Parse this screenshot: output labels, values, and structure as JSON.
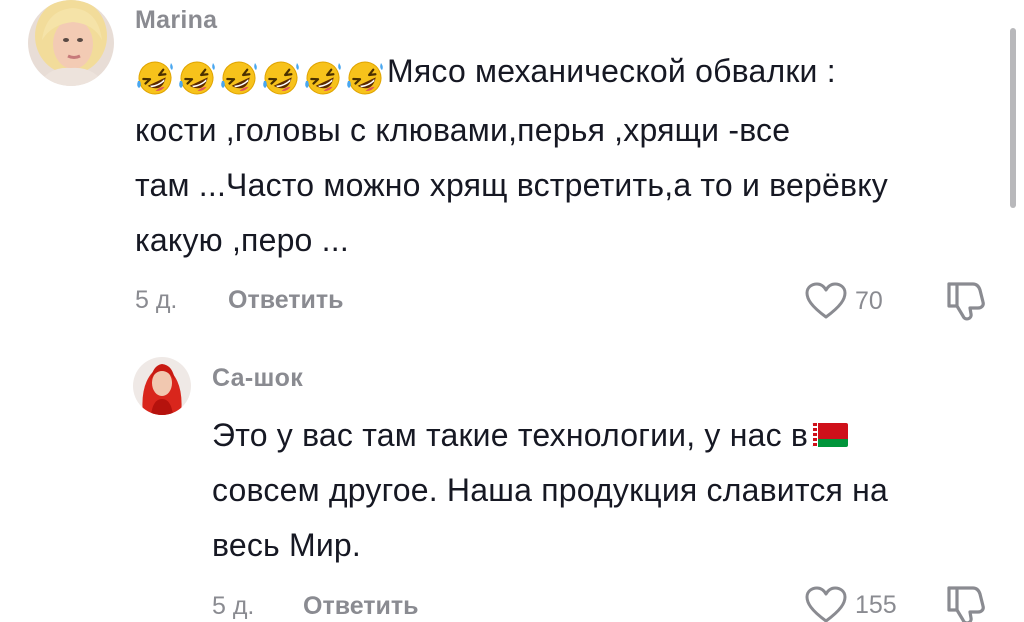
{
  "comments": [
    {
      "username": "Marina",
      "emojis": [
        "rolling-on-floor-laughing",
        "rolling-on-floor-laughing",
        "rolling-on-floor-laughing",
        "rolling-on-floor-laughing",
        "rolling-on-floor-laughing",
        "rolling-on-floor-laughing"
      ],
      "line1": "Мясо механической обвалки :",
      "line2": "кости ,головы с клювами,перья ,хрящи -все",
      "line3": "там ...Часто можно хрящ встретить,а то и верёвку",
      "line4": "какую ,перо ...",
      "time": "5 д.",
      "reply_label": "Ответить",
      "likes": "70"
    },
    {
      "username": "Са-шок",
      "line1": "Это у вас там такие технологии, у нас в",
      "flag": "belarus-flag",
      "line2": "совсем другое. Наша продукция славится на",
      "line3": "весь Мир.",
      "time": "5 д.",
      "reply_label": "Ответить",
      "likes": "155"
    }
  ],
  "colors": {
    "text": "#161823",
    "muted": "#8a8b91"
  }
}
